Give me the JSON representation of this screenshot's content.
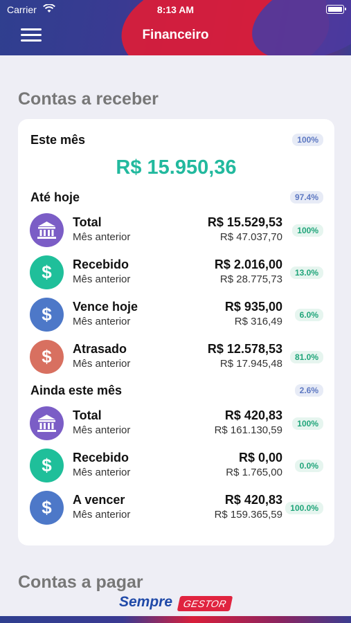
{
  "status_bar": {
    "carrier": "Carrier",
    "time": "8:13 AM"
  },
  "header": {
    "title": "Financeiro"
  },
  "receivable": {
    "section_title": "Contas a receber",
    "this_month": {
      "label": "Este mês",
      "percent": "100%",
      "value": "R$ 15.950,36"
    },
    "until_today": {
      "label": "Até hoje",
      "percent": "97.4%",
      "rows": [
        {
          "name": "Total",
          "sub": "Mês anterior",
          "amount": "R$ 15.529,53",
          "prev": "R$ 47.037,70",
          "percent": "100%",
          "icon": "bank-icon",
          "color": "#7b5dc6"
        },
        {
          "name": "Recebido",
          "sub": "Mês anterior",
          "amount": "R$ 2.016,00",
          "prev": "R$ 28.775,73",
          "percent": "13.0%",
          "icon": "dollar-icon",
          "color": "#1fbf9a"
        },
        {
          "name": "Vence hoje",
          "sub": "Mês anterior",
          "amount": "R$ 935,00",
          "prev": "R$ 316,49",
          "percent": "6.0%",
          "icon": "dollar-icon",
          "color": "#4d78c8"
        },
        {
          "name": "Atrasado",
          "sub": "Mês anterior",
          "amount": "R$ 12.578,53",
          "prev": "R$ 17.945,48",
          "percent": "81.0%",
          "icon": "dollar-icon",
          "color": "#d87060"
        }
      ]
    },
    "rest_of_month": {
      "label": "Ainda este mês",
      "percent": "2.6%",
      "rows": [
        {
          "name": "Total",
          "sub": "Mês anterior",
          "amount": "R$ 420,83",
          "prev": "R$ 161.130,59",
          "percent": "100%",
          "icon": "bank-icon",
          "color": "#7b5dc6"
        },
        {
          "name": "Recebido",
          "sub": "Mês anterior",
          "amount": "R$ 0,00",
          "prev": "R$ 1.765,00",
          "percent": "0.0%",
          "icon": "dollar-icon",
          "color": "#1fbf9a"
        },
        {
          "name": "A vencer",
          "sub": "Mês anterior",
          "amount": "R$ 420,83",
          "prev": "R$ 159.365,59",
          "percent": "100.0%",
          "icon": "dollar-icon",
          "color": "#4d78c8"
        }
      ]
    }
  },
  "payable": {
    "section_title": "Contas a pagar"
  },
  "logo": {
    "text1": "Sempre",
    "text2": "GESTOR"
  }
}
